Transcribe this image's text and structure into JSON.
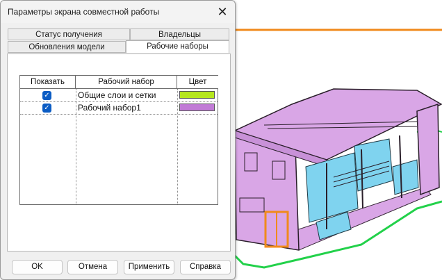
{
  "dialog": {
    "title": "Параметры экрана совместной работы",
    "close_glyph": "✕"
  },
  "tabs": {
    "row1": [
      "Статус получения",
      "Владельцы"
    ],
    "row2": [
      "Обновления модели",
      "Рабочие наборы"
    ],
    "active": "Рабочие наборы"
  },
  "table": {
    "headers": [
      "Показать",
      "Рабочий набор",
      "Цвет"
    ],
    "rows": [
      {
        "show": true,
        "name": "Общие слои и сетки",
        "color": "#b5e61d"
      },
      {
        "show": true,
        "name": "Рабочий набор1",
        "color": "#c17bd6"
      }
    ]
  },
  "buttons": {
    "ok": "OK",
    "cancel": "Отмена",
    "apply": "Применить",
    "help": "Справка"
  },
  "colors": {
    "accent_orange": "#f08a1c",
    "checkbox_blue": "#0b5cc4",
    "model_purple": "#d9a6e6",
    "model_cyan": "#7fd3ef",
    "model_green": "#22d14a"
  }
}
